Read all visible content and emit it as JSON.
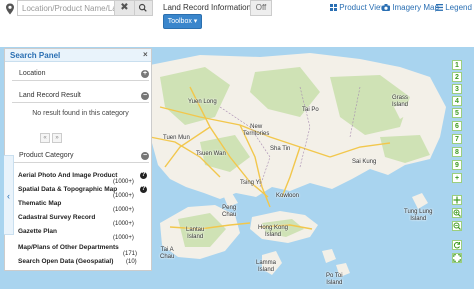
{
  "search": {
    "placeholder": "Location/Product Name/Land",
    "clear_symbol": "✖"
  },
  "header": {
    "land_record_label": "Land Record Information",
    "land_record_toggle": "Off",
    "product_view": "Product View",
    "imagery_map": "Imagery Map",
    "legend": "Legend",
    "toolbox": "Toolbox ▾"
  },
  "panel": {
    "title": "Search Panel",
    "close": "×",
    "sections": {
      "location": "Location",
      "land_record_result": "Land Record Result",
      "product_category": "Product Category"
    },
    "no_result": "No result found in this category",
    "pager": {
      "prev": "«",
      "next": "»"
    },
    "categories": [
      {
        "label": "Aerial Photo And Image Product",
        "count": "(1000+)"
      },
      {
        "label": "Spatial Data & Topographic Map",
        "count": "(1000+)"
      },
      {
        "label": "Thematic Map",
        "count": "(1000+)"
      },
      {
        "label": "Cadastral Survey Record",
        "count": "(1000+)"
      },
      {
        "label": "Gazette Plan",
        "count": "(1000+)"
      },
      {
        "label": "Map/Plans of Other Departments",
        "count": "(171)"
      },
      {
        "label": "Search Open Data (Geospatial)",
        "count": "(10)"
      }
    ],
    "collapse_symbol": "‹"
  },
  "map": {
    "labels": {
      "new_territories": "New\nTerritories",
      "tsuen_wan": "Tsuen Wan",
      "sha_tin": "Sha Tin",
      "tai_po": "Tai Po",
      "sai_kung": "Sai Kung",
      "yuen_long": "Yuen Long",
      "tuen_mun": "Tuen Mun",
      "kowloon": "Kowloon",
      "hong_kong_island": "Hong Kong\nIsland",
      "lantau_island": "Lantau\nIsland",
      "lamma_island": "Lamma\nIsland",
      "tsing_yi": "Tsing Yi",
      "grass_island": "Grass\nIsland",
      "tung_lung": "Tung Lung\nIsland",
      "peng_chau": "Peng\nChau",
      "tai_a_chau": "Tai A\nChau",
      "po_toi": "Po Toi\nIsland"
    }
  },
  "right_toolbar": {
    "levels": [
      "1",
      "2",
      "3",
      "4",
      "5",
      "6",
      "7",
      "8",
      "9"
    ],
    "plus": "+"
  },
  "colors": {
    "accent": "#2a6fb3",
    "toolbox": "#3a86cc",
    "sea": "#a9d4ef",
    "land": "#f3f0e8",
    "vegetation": "#cfe2b5",
    "road": "#f2c74c",
    "tool_green": "#3e9a1f"
  }
}
